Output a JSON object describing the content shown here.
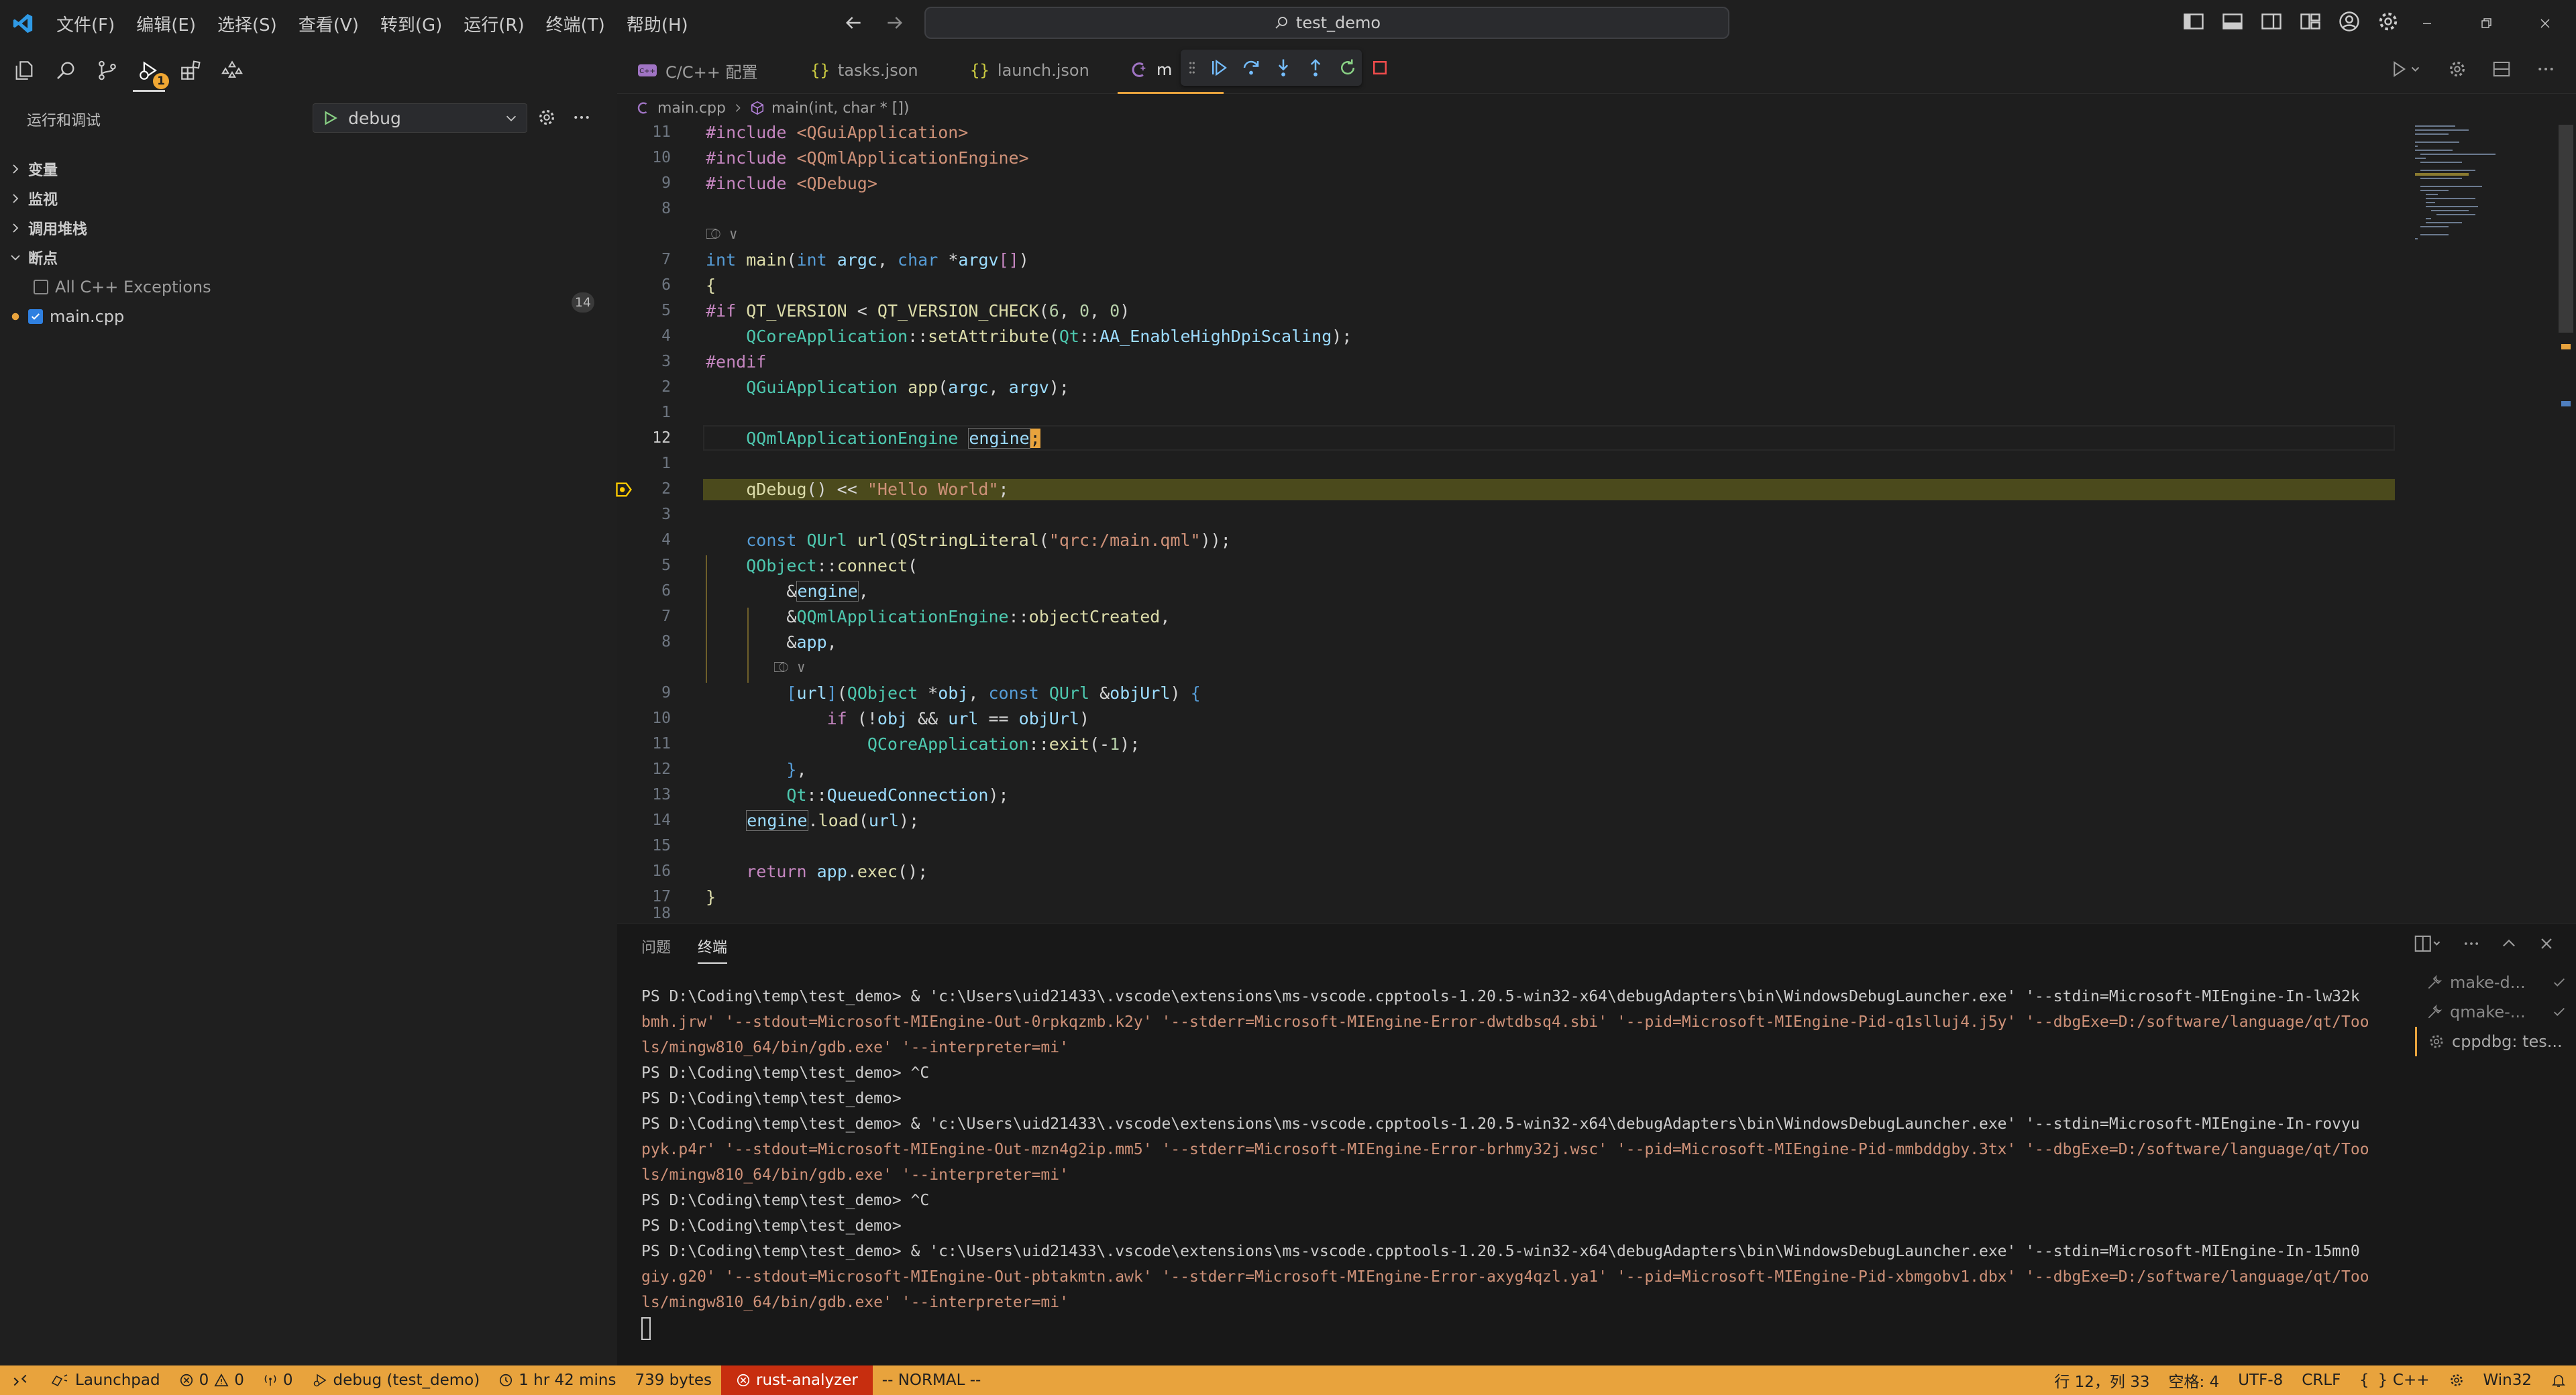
{
  "title_bar": {
    "menus": [
      "文件(F)",
      "编辑(E)",
      "选择(S)",
      "查看(V)",
      "转到(G)",
      "运行(R)",
      "终端(T)",
      "帮助(H)"
    ],
    "search_text": "test_demo"
  },
  "activity_bar": {
    "debug_badge": "1"
  },
  "sidebar": {
    "header": "运行和调试",
    "config_select": "debug",
    "sections": [
      "变量",
      "监视",
      "调用堆栈",
      "断点"
    ],
    "breakpoints": [
      {
        "label": "All C++ Exceptions",
        "checked": false
      },
      {
        "label": "main.cpp",
        "checked": true,
        "line": "14"
      }
    ]
  },
  "tabs": [
    {
      "label": "C/C++ 配置",
      "icon": "cpp-config-icon"
    },
    {
      "label": "tasks.json",
      "icon": "json-braces-icon"
    },
    {
      "label": "launch.json",
      "icon": "json-braces-icon"
    },
    {
      "label": "m",
      "icon": "cpp-file-icon",
      "active": true
    }
  ],
  "breadcrumb": {
    "file": "main.cpp",
    "symbol": "main(int, char * [])"
  },
  "editor": {
    "line_numbers": [
      "11",
      "10",
      "9",
      "8",
      "",
      "7",
      "6",
      "5",
      "4",
      "3",
      "2",
      "1",
      "12",
      "1",
      "2",
      "3",
      "4",
      "5",
      "6",
      "7",
      "8",
      "",
      "9",
      "10",
      "11",
      "12",
      "13",
      "14",
      "15",
      "16",
      "17",
      "18"
    ],
    "codelens": "⎄ ∨"
  },
  "panel": {
    "tabs": [
      "问题",
      "终端"
    ],
    "terminal_lines": [
      "PS D:\\Coding\\temp\\test_demo>  & 'c:\\Users\\uid21433\\.vscode\\extensions\\ms-vscode.cpptools-1.20.5-win32-x64\\debugAdapters\\bin\\WindowsDebugLauncher.exe' '--stdin=Microsoft-MIEngine-In-lw32k",
      "bmh.jrw' '--stdout=Microsoft-MIEngine-Out-0rpkqzmb.k2y' '--stderr=Microsoft-MIEngine-Error-dwtdbsq4.sbi' '--pid=Microsoft-MIEngine-Pid-q1slluj4.j5y' '--dbgExe=D:/software/language/qt/Too",
      "ls/mingw810_64/bin/gdb.exe' '--interpreter=mi'",
      "PS D:\\Coding\\temp\\test_demo> ^C",
      "PS D:\\Coding\\temp\\test_demo>",
      "PS D:\\Coding\\temp\\test_demo>  & 'c:\\Users\\uid21433\\.vscode\\extensions\\ms-vscode.cpptools-1.20.5-win32-x64\\debugAdapters\\bin\\WindowsDebugLauncher.exe' '--stdin=Microsoft-MIEngine-In-rovyu",
      "pyk.p4r' '--stdout=Microsoft-MIEngine-Out-mzn4g2ip.mm5' '--stderr=Microsoft-MIEngine-Error-brhmy32j.wsc' '--pid=Microsoft-MIEngine-Pid-mmbddgby.3tx' '--dbgExe=D:/software/language/qt/Too",
      "ls/mingw810_64/bin/gdb.exe' '--interpreter=mi'",
      "PS D:\\Coding\\temp\\test_demo> ^C",
      "PS D:\\Coding\\temp\\test_demo>",
      "PS D:\\Coding\\temp\\test_demo>  & 'c:\\Users\\uid21433\\.vscode\\extensions\\ms-vscode.cpptools-1.20.5-win32-x64\\debugAdapters\\bin\\WindowsDebugLauncher.exe' '--stdin=Microsoft-MIEngine-In-15mn0",
      "giy.g20' '--stdout=Microsoft-MIEngine-Out-pbtakmtn.awk' '--stderr=Microsoft-MIEngine-Error-axyg4qzl.ya1' '--pid=Microsoft-MIEngine-Pid-xbmgobv1.dbx' '--dbgExe=D:/software/language/qt/Too",
      "ls/mingw810_64/bin/gdb.exe' '--interpreter=mi'"
    ],
    "terminals": [
      {
        "label": "make-d...",
        "icon": "tools-icon"
      },
      {
        "label": "qmake-...",
        "icon": "tools-icon"
      },
      {
        "label": "cppdbg: tes...",
        "icon": "debug-gear-icon",
        "active": true
      }
    ]
  },
  "status_bar": {
    "launchpad": "Launchpad",
    "errors": "0",
    "warnings": "0",
    "ports": "0",
    "debug_target": "debug (test_demo)",
    "time": "1 hr 42 mins",
    "size": "739 bytes",
    "rust": "rust-analyzer",
    "mode": "-- NORMAL --",
    "position": "行 12，列 33",
    "spaces": "空格: 4",
    "encoding": "UTF-8",
    "eol": "CRLF",
    "language": "C++",
    "platform": "Win32"
  },
  "colors": {
    "status_bar": "#e8a33d",
    "rust_analyzer": "#c72e0f",
    "debug_line": "#4b4a1c",
    "tab_accent": "#e8a33d"
  }
}
